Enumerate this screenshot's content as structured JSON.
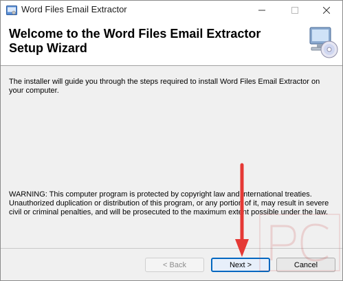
{
  "window": {
    "title": "Word Files Email Extractor",
    "controls": {
      "minimize_icon": "minimize-icon",
      "maximize_icon": "maximize-icon",
      "close_icon": "close-icon"
    }
  },
  "header": {
    "title": "Welcome to the Word Files Email Extractor Setup Wizard",
    "graphic_icon": "computer-cd-icon"
  },
  "content": {
    "intro": "The installer will guide you through the steps required to install Word Files Email Extractor  on your computer.",
    "warning": "WARNING: This computer program is protected by copyright law and international treaties. Unauthorized duplication or distribution of this program, or any portion of it, may result in severe civil or criminal penalties, and will be prosecuted to the maximum extent possible under the law."
  },
  "buttons": {
    "back": "< Back",
    "back_enabled": false,
    "next": "Next >",
    "cancel": "Cancel"
  },
  "annotation": {
    "arrow_color": "#e53935",
    "icon": "red-arrow-icon"
  },
  "colors": {
    "accent": "#0067c0",
    "arrow": "#e53935"
  }
}
